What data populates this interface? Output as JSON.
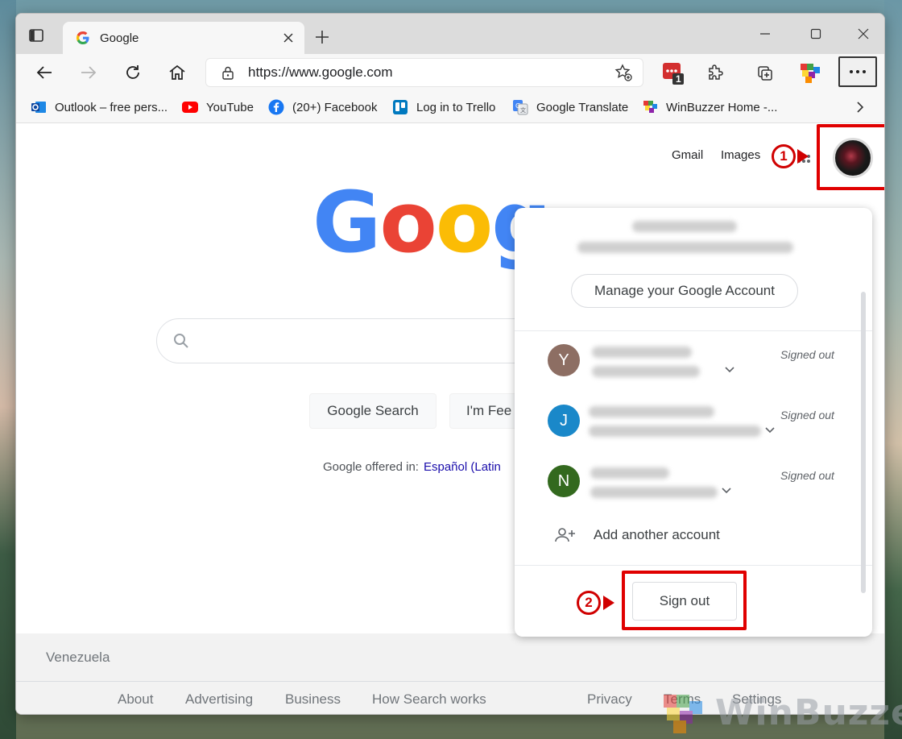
{
  "tab": {
    "title": "Google"
  },
  "address": {
    "url": "https://www.google.com"
  },
  "extensions": {
    "badge_count": "1"
  },
  "bookmarks": [
    {
      "label": "Outlook – free pers...",
      "icon": "outlook-icon"
    },
    {
      "label": "YouTube",
      "icon": "youtube-icon"
    },
    {
      "label": "(20+) Facebook",
      "icon": "facebook-icon"
    },
    {
      "label": "Log in to Trello",
      "icon": "trello-icon"
    },
    {
      "label": "Google Translate",
      "icon": "translate-icon"
    },
    {
      "label": "WinBuzzer Home -...",
      "icon": "winbuzzer-icon"
    }
  ],
  "page": {
    "gmail": "Gmail",
    "images": "Images",
    "logo_letters": [
      "G",
      "o",
      "o",
      "g"
    ],
    "logo_colors": [
      "#4285F4",
      "#EA4335",
      "#FBBC05",
      "#4285F4",
      "#34A853"
    ],
    "search_button": "Google Search",
    "lucky_button": "I'm Fee",
    "offered_in": "Google offered in:",
    "offered_lang": "Español (Latin",
    "country": "Venezuela",
    "footer": [
      "About",
      "Advertising",
      "Business",
      "How Search works",
      "Privacy",
      "Terms",
      "Settings"
    ]
  },
  "annotations": {
    "step1": "1",
    "step2": "2",
    "highlight_color": "#E00000"
  },
  "popup": {
    "manage": "Manage your Google Account",
    "accounts": [
      {
        "initial": "Y",
        "color": "#8d6e63",
        "status": "Signed out"
      },
      {
        "initial": "J",
        "color": "#1a88c9",
        "status": "Signed out"
      },
      {
        "initial": "N",
        "color": "#33691e",
        "status": "Signed out"
      }
    ],
    "add_account": "Add another account",
    "sign_out": "Sign out"
  },
  "watermark": {
    "text": "WinBuzzer"
  }
}
